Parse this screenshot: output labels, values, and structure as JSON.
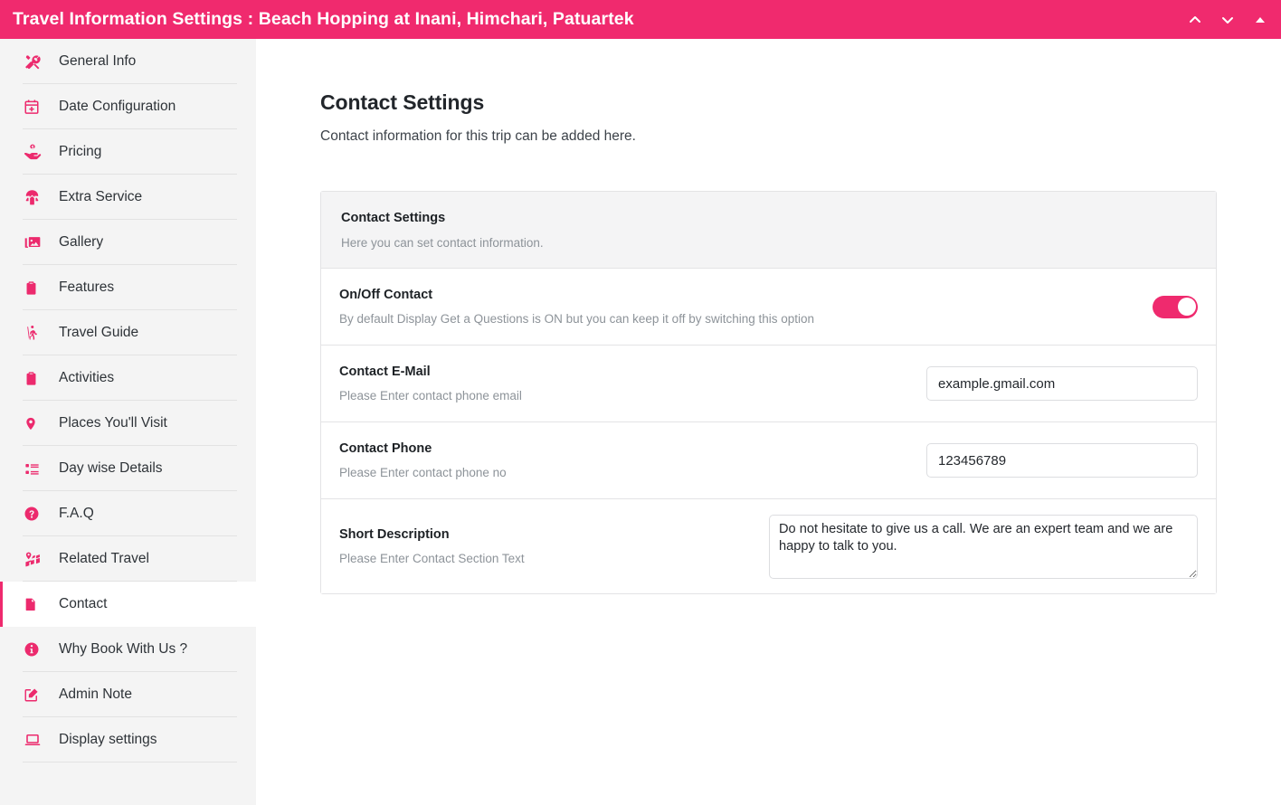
{
  "topbar": {
    "title": "Travel Information Settings : Beach Hopping at Inani, Himchari, Patuartek",
    "accent_color": "#f02a6e",
    "actions": [
      {
        "name": "chevron-up-icon",
        "label": ""
      },
      {
        "name": "chevron-down-icon",
        "label": ""
      },
      {
        "name": "triangle-up-icon",
        "label": ""
      }
    ]
  },
  "sidebar": {
    "items": [
      {
        "label": "General Info",
        "icon": "tools-icon",
        "active": false
      },
      {
        "label": "Date Configuration",
        "icon": "calendar-plus-icon",
        "active": false
      },
      {
        "label": "Pricing",
        "icon": "hand-holding-dollar-icon",
        "active": false
      },
      {
        "label": "Extra Service",
        "icon": "parachute-box-icon",
        "active": false
      },
      {
        "label": "Gallery",
        "icon": "images-icon",
        "active": false
      },
      {
        "label": "Features",
        "icon": "clipboard-list-icon",
        "active": false
      },
      {
        "label": "Travel Guide",
        "icon": "hiking-icon",
        "active": false
      },
      {
        "label": "Activities",
        "icon": "clipboard-list-icon",
        "active": false
      },
      {
        "label": "Places You'll Visit",
        "icon": "map-marker-icon",
        "active": false
      },
      {
        "label": "Day wise Details",
        "icon": "list-ul-icon",
        "active": false
      },
      {
        "label": "F.A.Q",
        "icon": "question-circle-icon",
        "active": false
      },
      {
        "label": "Related Travel",
        "icon": "map-marked-icon",
        "active": false
      },
      {
        "label": "Contact",
        "icon": "file-lines-icon",
        "active": true
      },
      {
        "label": "Why Book With Us ?",
        "icon": "info-circle-icon",
        "active": false
      },
      {
        "label": "Admin Note",
        "icon": "pen-square-icon",
        "active": false
      },
      {
        "label": "Display settings",
        "icon": "desktop-icon",
        "active": false
      }
    ]
  },
  "main": {
    "page_title": "Contact Settings",
    "page_subtitle": "Contact information for this trip can be added here.",
    "card": {
      "header": {
        "title": "Contact Settings",
        "description": "Here you can set contact information."
      },
      "rows": [
        {
          "title": "On/Off Contact",
          "description": "By default Display Get a Questions is ON but you can keep it off by switching this option",
          "control": "toggle",
          "toggle_on": true
        },
        {
          "title": "Contact E-Mail",
          "description": "Please Enter contact phone email",
          "control": "input",
          "value": "example.gmail.com",
          "placeholder": "example.gmail.com"
        },
        {
          "title": "Contact Phone",
          "description": "Please Enter contact phone no",
          "control": "input",
          "value": "123456789",
          "placeholder": "123456789"
        },
        {
          "title": "Short Description",
          "description": "Please Enter Contact Section Text",
          "control": "textarea",
          "value": "Do not hesitate to give us a call. We are an expert team and we are happy to talk to you.",
          "placeholder": "Please Enter Contact Section Text"
        }
      ]
    }
  }
}
